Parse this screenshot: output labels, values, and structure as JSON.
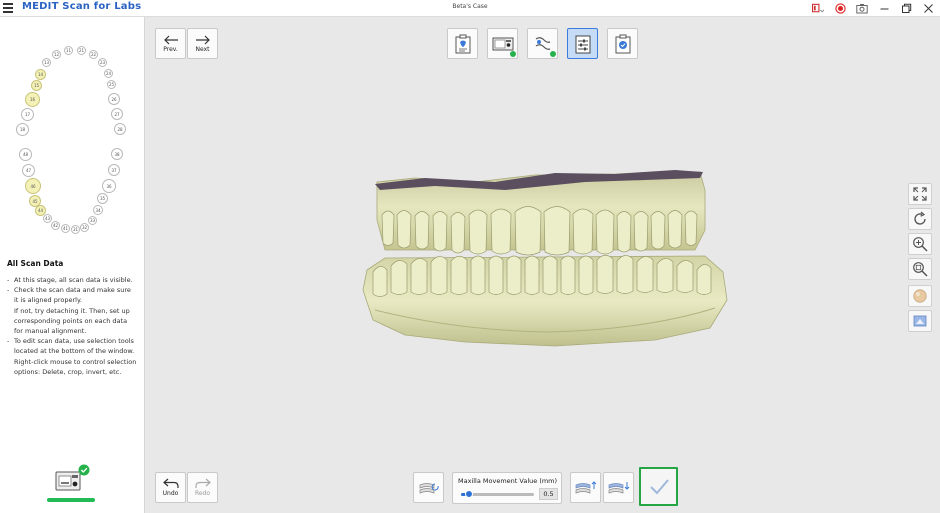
{
  "titlebar": {
    "app_name": "MEDIT Scan for Labs",
    "case_name": "Beta's Case",
    "icons": [
      "menu-icon",
      "layout-icon",
      "record-icon",
      "camera-icon",
      "minimize-icon",
      "restore-icon",
      "close-icon"
    ]
  },
  "nav": {
    "prev_label": "Prev.",
    "next_label": "Next"
  },
  "steps": [
    {
      "name": "arch-setup-step",
      "icon": "tooth-form-icon",
      "completed": false,
      "active": false
    },
    {
      "name": "scan-step",
      "icon": "scanner-icon",
      "completed": true,
      "active": false
    },
    {
      "name": "occlusion-step",
      "icon": "occlusion-icon",
      "completed": true,
      "active": false
    },
    {
      "name": "align-step",
      "icon": "sliders-icon",
      "completed": false,
      "active": true
    },
    {
      "name": "review-step",
      "icon": "clipboard-check-icon",
      "completed": false,
      "active": false
    }
  ],
  "tooth_chart": {
    "upper": [
      "11",
      "12",
      "13",
      "14",
      "15",
      "16",
      "17",
      "18",
      "21",
      "22",
      "23",
      "24",
      "25",
      "26",
      "27",
      "28"
    ],
    "lower": [
      "31",
      "32",
      "33",
      "34",
      "35",
      "36",
      "37",
      "38",
      "41",
      "42",
      "43",
      "44",
      "45",
      "46",
      "47",
      "48"
    ],
    "selected": [
      "14",
      "15",
      "16",
      "44",
      "45",
      "46"
    ]
  },
  "stage": {
    "title": "All Scan Data",
    "bullets": [
      {
        "text": "At this stage, all scan data is visible."
      },
      {
        "text": "Check the scan data and make sure it is aligned properly.",
        "extra": "If not, try detaching it. Then, set up corresponding points on each data for manual alignment."
      },
      {
        "text": "To edit scan data, use selection tools located at the bottom of the window.",
        "extra": "Right-click mouse to control selection options: Delete, crop, invert, etc."
      }
    ]
  },
  "history": {
    "undo_label": "Undo",
    "redo_label": "Redo"
  },
  "movement": {
    "label": "Maxilla Movement Value (mm)",
    "value": "0.5",
    "fraction": 0.1
  },
  "side_tools": [
    "fit-view-icon",
    "rotate-icon",
    "zoom-icon",
    "zoom-area-icon",
    "texture-icon",
    "view-mode-icon"
  ],
  "colors": {
    "accent": "#2b63c4",
    "complete": "#25b24a",
    "selected_tooth": "#f4f1b6",
    "model": "#e3e4b8",
    "model_shadow": "#b9ba84",
    "gum_top": "#5b4e5e"
  }
}
